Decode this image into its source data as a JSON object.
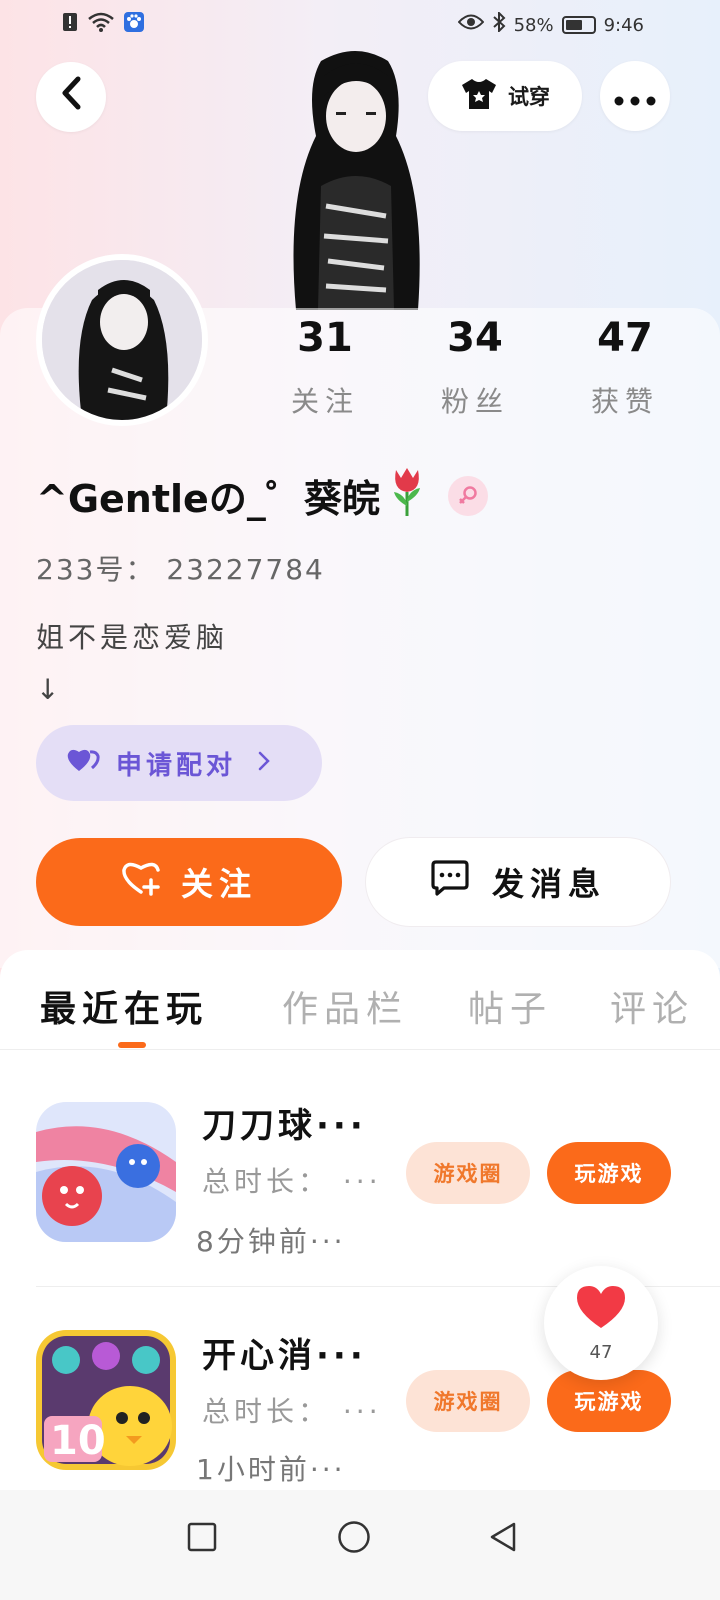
{
  "status_bar": {
    "battery": "58%",
    "time": "9:46"
  },
  "header": {
    "tryon_label": "试穿"
  },
  "stats": [
    {
      "value": "31",
      "label": "关注"
    },
    {
      "value": "34",
      "label": "粉丝"
    },
    {
      "value": "47",
      "label": "获赞"
    }
  ],
  "profile": {
    "username": "^Gentleの_゜葵皖",
    "uid": "233号： 23227784",
    "bio": "姐不是恋爱脑\n↓",
    "pair_label": "申请配对"
  },
  "actions": {
    "follow_label": "关注",
    "message_label": "发消息"
  },
  "tabs": [
    "最近在玩",
    "作品栏",
    "帖子",
    "评论"
  ],
  "games": [
    {
      "title": "刀刀球···",
      "meta": "总时长： ···",
      "time": "8分钟前···",
      "circle_label": "游戏圈",
      "play_label": "玩游戏"
    },
    {
      "title": "开心消···",
      "meta": "总时长： ···",
      "time": "1小时前···",
      "circle_label": "游戏圈",
      "play_label": "玩游戏"
    }
  ],
  "like_float": {
    "count": "47"
  },
  "colors": {
    "accent": "#fb6a1a",
    "pair_bg": "#e4def6",
    "pair_text": "#6b56d6",
    "heart": "#f23a45"
  }
}
